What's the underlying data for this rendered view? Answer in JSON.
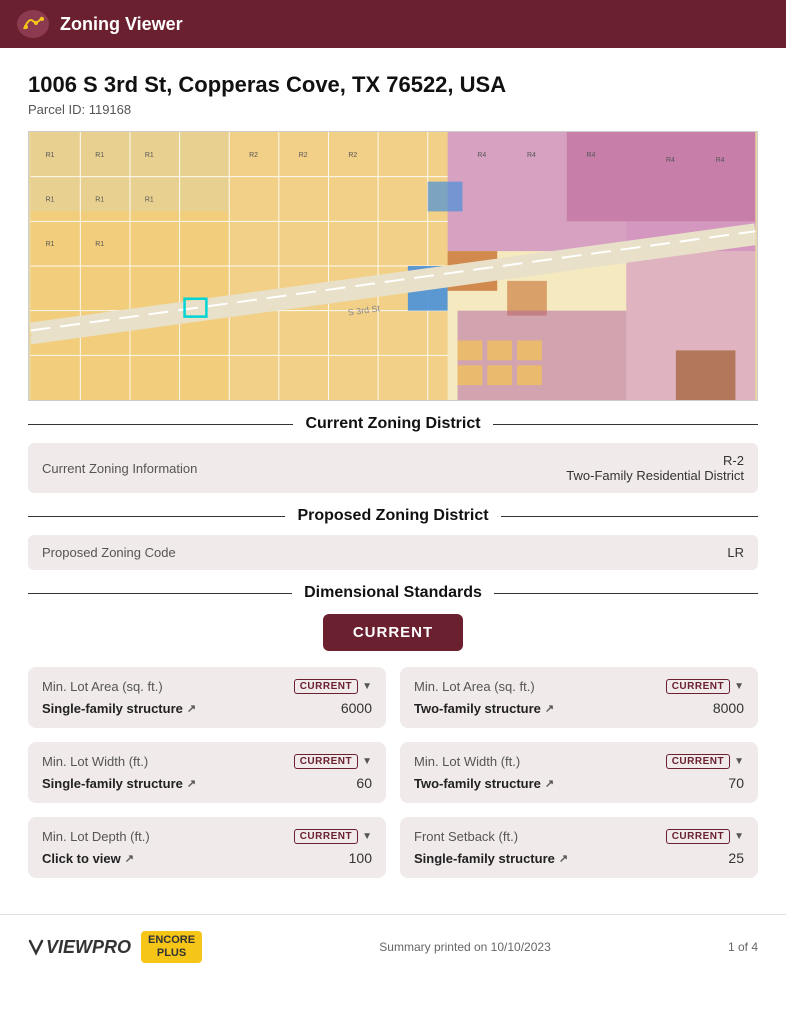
{
  "header": {
    "title": "Zoning Viewer",
    "logo_alt": "City of Copperas Cove logo"
  },
  "address": {
    "full": "1006 S 3rd St, Copperas Cove, TX 76522, USA",
    "parcel_label": "Parcel ID:",
    "parcel_id": "119168"
  },
  "current_zoning": {
    "section_title": "Current Zoning District",
    "label": "Current Zoning Information",
    "code": "R-2",
    "description": "Two-Family Residential District"
  },
  "proposed_zoning": {
    "section_title": "Proposed Zoning District",
    "label": "Proposed Zoning Code",
    "code": "LR"
  },
  "dimensional_standards": {
    "section_title": "Dimensional Standards",
    "current_button_label": "CURRENT",
    "cards": [
      {
        "id": "card1",
        "title": "Min. Lot Area (sq. ft.)",
        "badge": "CURRENT",
        "label": "Single-family structure",
        "value": "6000"
      },
      {
        "id": "card2",
        "title": "Min. Lot Area (sq. ft.)",
        "badge": "CURRENT",
        "label": "Two-family structure",
        "value": "8000"
      },
      {
        "id": "card3",
        "title": "Min. Lot Width (ft.)",
        "badge": "CURRENT",
        "label": "Single-family structure",
        "value": "60"
      },
      {
        "id": "card4",
        "title": "Min. Lot Width (ft.)",
        "badge": "CURRENT",
        "label": "Two-family structure",
        "value": "70"
      },
      {
        "id": "card5",
        "title": "Min. Lot Depth (ft.)",
        "badge": "CURRENT",
        "label": "Click to view",
        "value": "100"
      },
      {
        "id": "card6",
        "title": "Front Setback (ft.)",
        "badge": "CURRENT",
        "label": "Single-family structure",
        "value": "25"
      }
    ]
  },
  "footer": {
    "viewpro_label": "VIEWPRO",
    "encore_label": "ENCORE",
    "encore_sub": "PLUS",
    "summary_text": "Summary printed on 10/10/2023",
    "page_text": "1 of 4"
  },
  "colors": {
    "header_bg": "#6b2030",
    "badge_color": "#6b2030",
    "card_bg": "#f0eaea"
  }
}
